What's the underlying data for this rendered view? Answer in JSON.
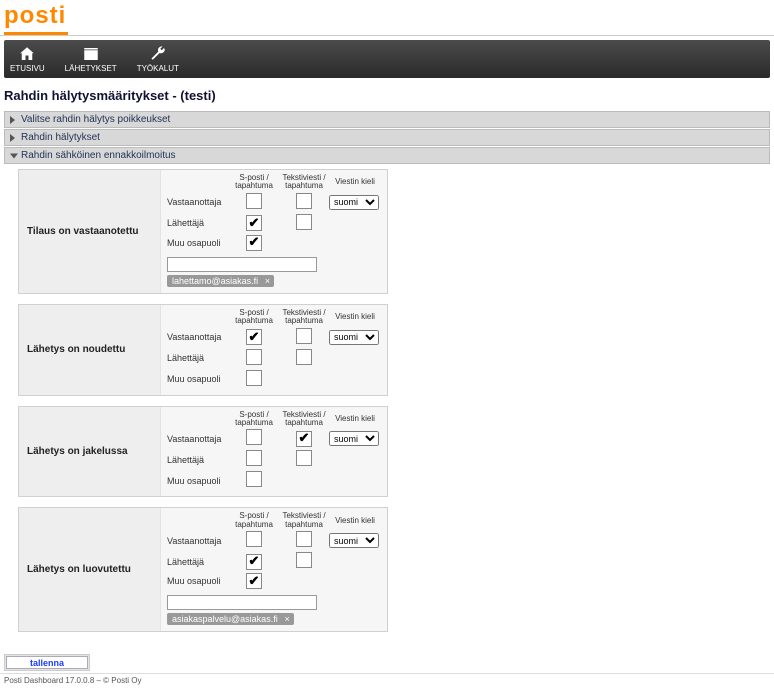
{
  "brand": {
    "name": "posti"
  },
  "nav": {
    "items": [
      {
        "key": "etusivu",
        "label": "ETUSIVU",
        "icon": "home-icon"
      },
      {
        "key": "lahetykset",
        "label": "LÄHETYKSET",
        "icon": "box-icon"
      },
      {
        "key": "tyokalut",
        "label": "TYÖKALUT",
        "icon": "wrench-icon"
      }
    ]
  },
  "page_title": "Rahdin hälytysmääritykset - (testi)",
  "accordions": {
    "a1": {
      "label": "Valitse rahdin hälytys poikkeukset",
      "open": false
    },
    "a2": {
      "label": "Rahdin hälytykset",
      "open": false
    },
    "a3": {
      "label": "Rahdin sähköinen ennakkoilmoitus",
      "open": true
    }
  },
  "column_headers": {
    "email": "S-posti /\ntapahtuma",
    "sms": "Tekstiviesti /\ntapahtuma",
    "lang": "Viestin kieli"
  },
  "role_labels": {
    "recipient": "Vastaanottaja",
    "sender": "Lähettäjä",
    "other": "Muu osapuoli"
  },
  "lang_options": [
    "suomi"
  ],
  "events": [
    {
      "key": "received",
      "title": "Tilaus on vastaanotettu",
      "rows": {
        "recipient": {
          "email": false,
          "sms": false
        },
        "sender": {
          "email": true,
          "sms": false
        },
        "other": {
          "email": true,
          "sms": null
        }
      },
      "lang": "suomi",
      "extra_input_value": "",
      "emails": [
        "lahettamo@asiakas.fi"
      ]
    },
    {
      "key": "picked_up",
      "title": "Lähetys on noudettu",
      "rows": {
        "recipient": {
          "email": true,
          "sms": false
        },
        "sender": {
          "email": false,
          "sms": false
        },
        "other": {
          "email": false,
          "sms": null
        }
      },
      "lang": "suomi",
      "extra_input_value": null,
      "emails": []
    },
    {
      "key": "in_delivery",
      "title": "Lähetys on jakelussa",
      "rows": {
        "recipient": {
          "email": false,
          "sms": true
        },
        "sender": {
          "email": false,
          "sms": false
        },
        "other": {
          "email": false,
          "sms": null
        }
      },
      "lang": "suomi",
      "extra_input_value": null,
      "emails": []
    },
    {
      "key": "delivered",
      "title": "Lähetys on luovutettu",
      "rows": {
        "recipient": {
          "email": false,
          "sms": false
        },
        "sender": {
          "email": true,
          "sms": false
        },
        "other": {
          "email": true,
          "sms": null
        }
      },
      "lang": "suomi",
      "extra_input_value": "",
      "emails": [
        "asiakaspalvelu@asiakas.fi"
      ]
    }
  ],
  "save_label": "tallenna",
  "footer": "Posti Dashboard 17.0.0.8 – © Posti Oy"
}
